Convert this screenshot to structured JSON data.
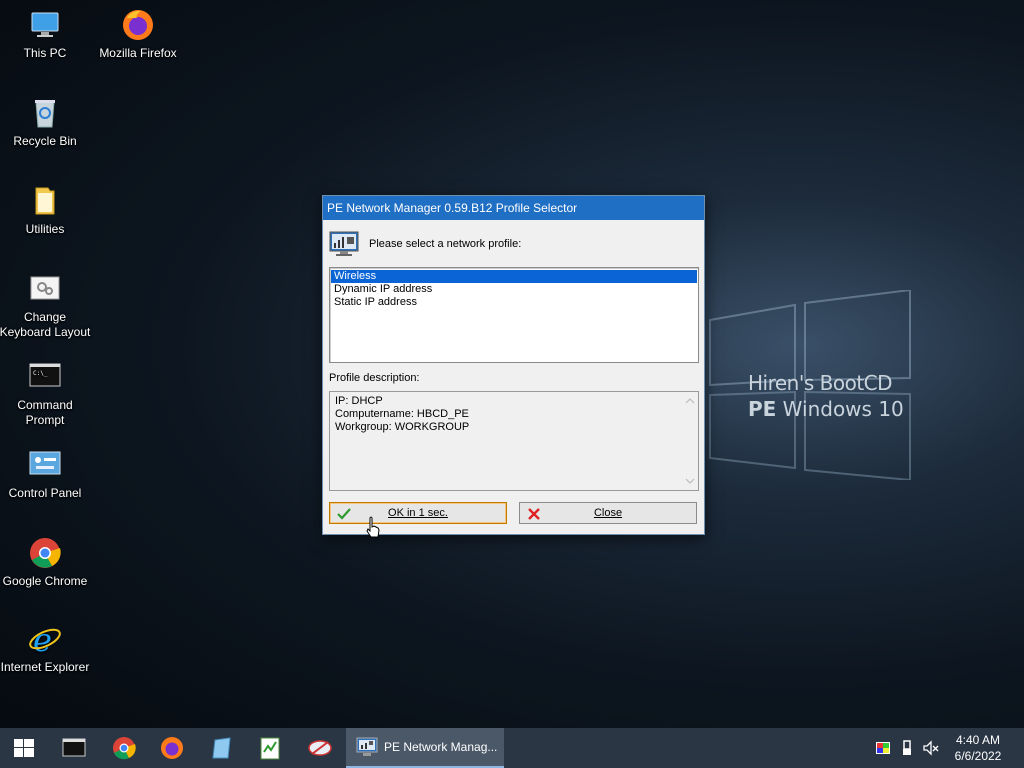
{
  "wallpaper": {
    "line1": "Hiren's BootCD",
    "line2_bold": "PE",
    "line2_rest": " Windows 10"
  },
  "desktop_icons": [
    {
      "label": "This PC"
    },
    {
      "label": "Mozilla Firefox"
    },
    {
      "label": "Recycle Bin"
    },
    {
      "label": "Utilities"
    },
    {
      "label": "Change Keyboard Layout"
    },
    {
      "label": "Command Prompt"
    },
    {
      "label": "Control Panel"
    },
    {
      "label": "Google Chrome"
    },
    {
      "label": "Internet Explorer"
    }
  ],
  "dialog": {
    "title": "PE Network Manager 0.59.B12 Profile Selector",
    "prompt": "Please select a network profile:",
    "profiles": [
      "Wireless",
      "Dynamic IP address",
      "Static IP address"
    ],
    "selected_profile": "Wireless",
    "description_label": "Profile description:",
    "description_lines": [
      "IP: DHCP",
      "Computername: HBCD_PE",
      "Workgroup: WORKGROUP"
    ],
    "ok_label": "OK in 1 sec.",
    "close_label": "Close"
  },
  "taskbar": {
    "active_task": "PE Network Manag...",
    "time": "4:40 AM",
    "date": "6/6/2022"
  },
  "colors": {
    "accent": "#1f6fc5",
    "selection": "#0a64d6",
    "taskbar": "#2a3644"
  }
}
